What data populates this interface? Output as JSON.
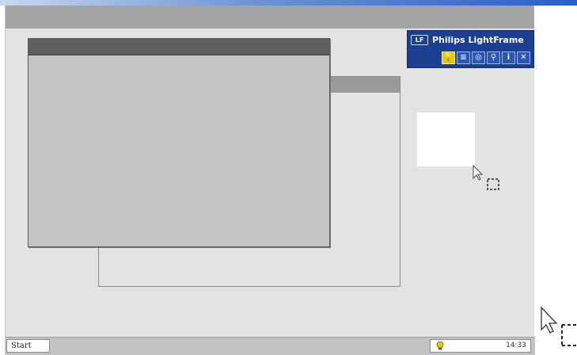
{
  "widget": {
    "title": "Philips LightFrame",
    "logo_text": "LF",
    "buttons": [
      {
        "icon": "bulb-icon",
        "glyph": "💡",
        "active": true
      },
      {
        "icon": "list-icon",
        "glyph": "≡",
        "active": false
      },
      {
        "icon": "power-icon",
        "glyph": "◎",
        "active": false
      },
      {
        "icon": "search-icon",
        "glyph": "⚲",
        "active": false
      },
      {
        "icon": "info-icon",
        "glyph": "i",
        "active": false
      },
      {
        "icon": "close-icon",
        "glyph": "✕",
        "active": false
      }
    ]
  },
  "taskbar": {
    "start_label": "Start",
    "clock": "14:33",
    "tray_icon": "bulb-icon"
  },
  "colors": {
    "widget_bg": "#1d3f8f",
    "active_button": "#f2c400",
    "desktop": "#e3e3e3"
  }
}
